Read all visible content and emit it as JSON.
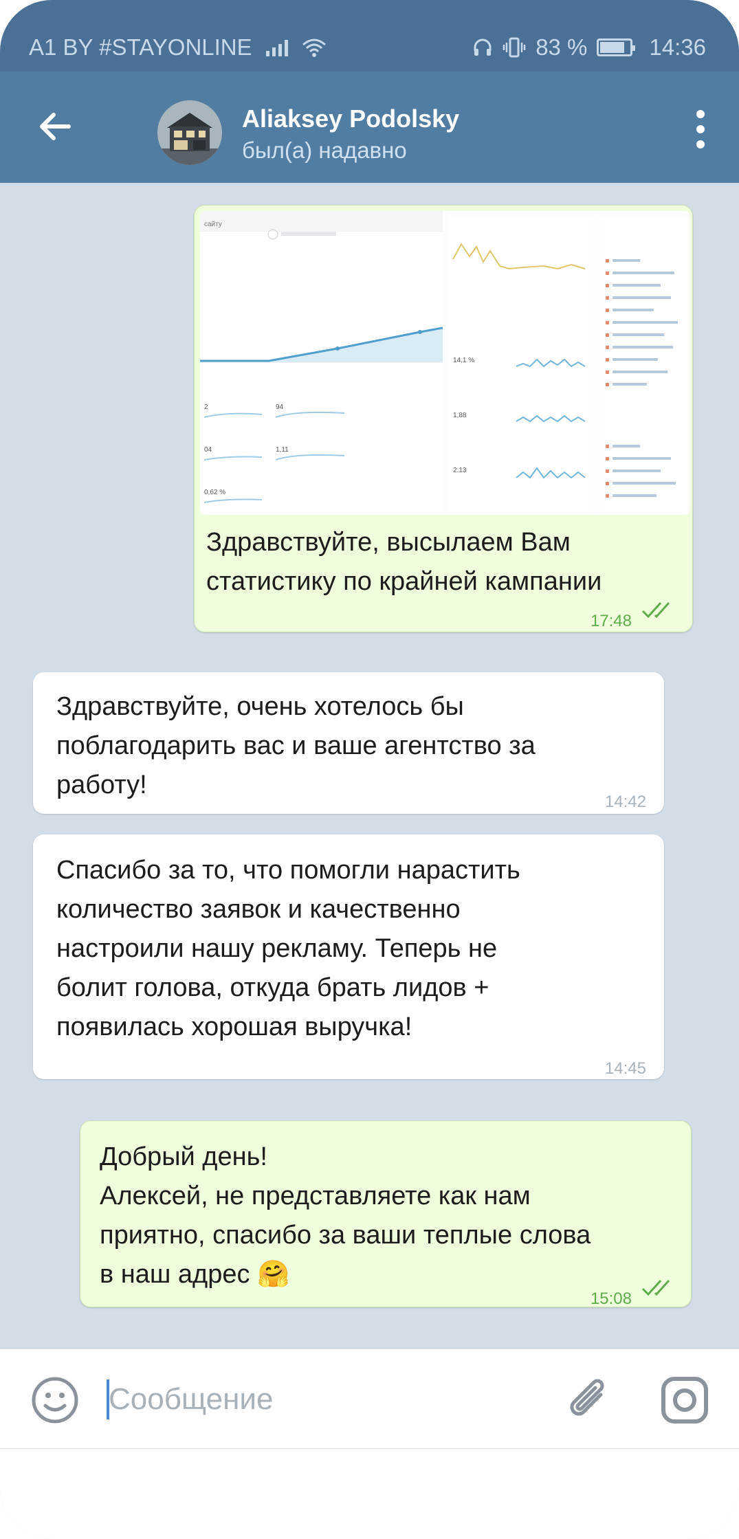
{
  "status_bar": {
    "carrier": "A1 BY #STAYONLINE",
    "battery": "83 %",
    "battery_level": 0.83,
    "time": "14:36"
  },
  "header": {
    "contact_name": "Aliaksey Podolsky",
    "last_seen": "был(а) надавно"
  },
  "messages": [
    {
      "direction": "out",
      "has_image": true,
      "text": "Здравствуйте, высылаем Вам\nстатистику по крайней кампании",
      "time": "17:48",
      "read": true
    },
    {
      "direction": "in",
      "text": "Здравствуйте, очень хотелось бы\nпоблагодарить вас и ваше агентство за\nработу!",
      "time": "14:42"
    },
    {
      "direction": "in",
      "text": "Спасибо за то, что помогли нарастить\nколичество заявок и качественно\nнастроили нашу рекламу. Теперь не\nболит голова, откуда брать лидов +\nпоявилась хорошая выручка!",
      "time": "14:45"
    },
    {
      "direction": "out",
      "text": "Добрый день!\nАлексей, не представляете как нам\nприятно, спасибо за ваши теплые слова\nв наш адрес",
      "emoji": "🤗",
      "time": "15:08",
      "read": true
    }
  ],
  "screenshot_stats": {
    "tab": "сайту",
    "metrics": [
      "2",
      "94",
      "04",
      "1,11",
      "0,62 %"
    ],
    "right_metrics": [
      "14,1 %",
      "1,88",
      "2:13"
    ]
  },
  "composer": {
    "placeholder": "Сообщение"
  },
  "icons": {
    "back": "arrow-left-icon",
    "more": "more-vert-icon",
    "emoji": "smile-icon",
    "attach": "paperclip-icon",
    "camera": "camera-icon"
  },
  "colors": {
    "header": "#517da2",
    "status_bar": "#4a7096",
    "chat_bg": "#d2dde8",
    "outgoing_bubble": "#effedd",
    "incoming_bubble": "#ffffff",
    "accent_green": "#5fad4a"
  }
}
